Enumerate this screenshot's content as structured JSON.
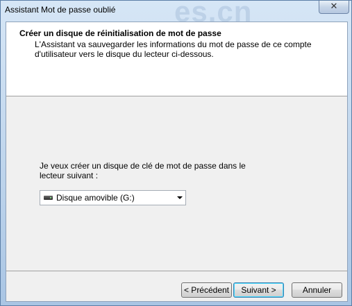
{
  "window": {
    "title": "Assistant Mot de passe oublié",
    "watermark": "es.cn",
    "close_glyph": "✕"
  },
  "header": {
    "title": "Créer un disque de réinitialisation de mot de passe",
    "description": "L'Assistant va sauvegarder les informations du mot de passe de ce compte d'utilisateur vers le disque du lecteur ci-dessous."
  },
  "main": {
    "prompt": "Je veux créer un disque de clé de mot de passe dans le lecteur suivant :",
    "drive_select": {
      "value": "Disque amovible (G:)",
      "icon": "removable-drive-icon"
    }
  },
  "footer": {
    "back_label": "< Précédent",
    "next_label": "Suivant >",
    "cancel_label": "Annuler"
  }
}
